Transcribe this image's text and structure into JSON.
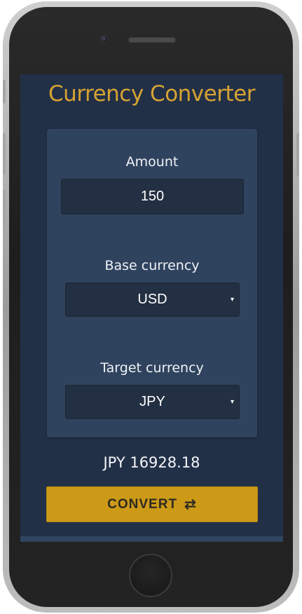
{
  "app": {
    "title": "Currency Converter"
  },
  "form": {
    "amount_label": "Amount",
    "amount_value": "150",
    "base_label": "Base currency",
    "base_value": "USD",
    "target_label": "Target currency",
    "target_value": "JPY",
    "caret_glyph": "▾"
  },
  "result": {
    "text": "JPY 16928.18"
  },
  "actions": {
    "convert_label": "CONVERT",
    "convert_icon": "⇄"
  },
  "colors": {
    "screen_background": "#223047",
    "card_background": "#30435e",
    "title_accent": "#d6a332",
    "button_accent": "#cc9a17"
  }
}
